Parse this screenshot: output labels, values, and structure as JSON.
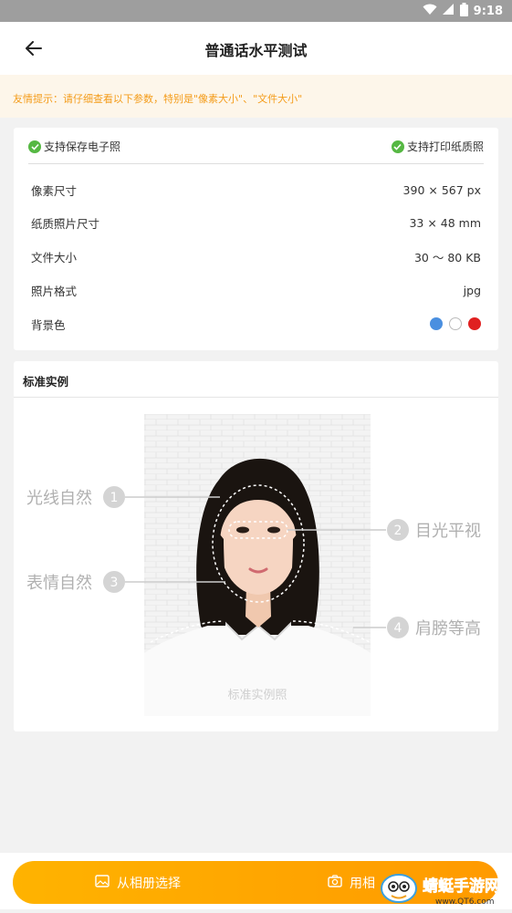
{
  "status_bar": {
    "time": "9:18"
  },
  "header": {
    "title": "普通话水平测试"
  },
  "tip": {
    "text": "友情提示：请仔细查看以下参数，特别是\"像素大小\"、\"文件大小\""
  },
  "support": {
    "left_label": "支持保存电子照",
    "right_label": "支持打印纸质照"
  },
  "params": [
    {
      "label": "像素尺寸",
      "value": "390 × 567 px"
    },
    {
      "label": "纸质照片尺寸",
      "value": "33 × 48 mm"
    },
    {
      "label": "文件大小",
      "value": "30 ～ 80 KB"
    },
    {
      "label": "照片格式",
      "value": "jpg"
    },
    {
      "label": "背景色",
      "value": ""
    }
  ],
  "bg_colors": [
    "#4a8fe0",
    "#ffffff",
    "#e02020"
  ],
  "sample": {
    "title": "标准实例",
    "photo_caption": "标准实例照",
    "annotations": [
      {
        "num": "1",
        "text": "光线自然"
      },
      {
        "num": "2",
        "text": "目光平视"
      },
      {
        "num": "3",
        "text": "表情自然"
      },
      {
        "num": "4",
        "text": "肩膀等高"
      }
    ]
  },
  "actions": {
    "album_label": "从相册选择",
    "camera_label": "用相"
  },
  "watermark": {
    "brand": "蜻蜓手游网",
    "site": "www.QT6.com"
  },
  "colors": {
    "accent": "#ffa000",
    "check": "#56b843",
    "tip_text": "#f49c1a"
  }
}
